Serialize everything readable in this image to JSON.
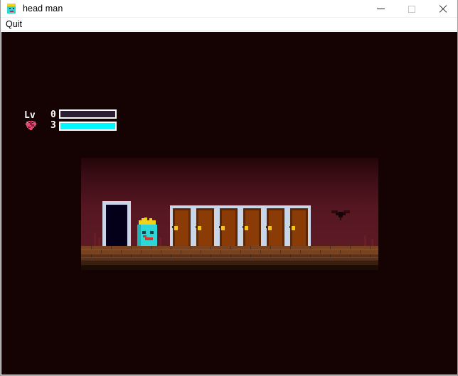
{
  "window": {
    "title": "head man",
    "icon": "head-man-icon",
    "controls": {
      "minimize": "minimize-icon",
      "maximize": "maximize-icon",
      "close": "close-icon"
    }
  },
  "menubar": {
    "items": [
      {
        "label": "Quit"
      }
    ]
  },
  "hud": {
    "level_label": "Lv",
    "level_value": "0",
    "health_icon": "heart-icon",
    "health_value": "3",
    "xp_bar": {
      "name": "xp-bar",
      "fill_percent": 0,
      "fill_color": "#00f7ff",
      "empty_color": "#2b1f33",
      "border_color": "#ffffff"
    },
    "hp_bar": {
      "name": "hp-bar",
      "fill_percent": 100,
      "fill_color": "#00f7ff",
      "empty_color": "#2b1f33",
      "border_color": "#ffffff"
    }
  },
  "scene": {
    "background_color": "#140302",
    "sky_top_color": "#230608",
    "sky_bottom_color": "#5c1a24",
    "ground_color": "#7a4320",
    "entities": {
      "player": {
        "name": "player-head-man",
        "crown_color": "#f2d21a",
        "skin_color": "#2fd6d6",
        "mouth_color": "#d4352f"
      },
      "open_doorway": {
        "name": "open-doorway",
        "frame_color": "#c9d6e8",
        "void_color": "#090224"
      },
      "closed_doors": {
        "name": "closed-door",
        "count": 6,
        "frame_color": "#c9d6e8",
        "panel_color": "#8a3b06",
        "knob_color": "#f5c518"
      },
      "bat": {
        "name": "bat-enemy",
        "color": "#30090f"
      }
    }
  }
}
